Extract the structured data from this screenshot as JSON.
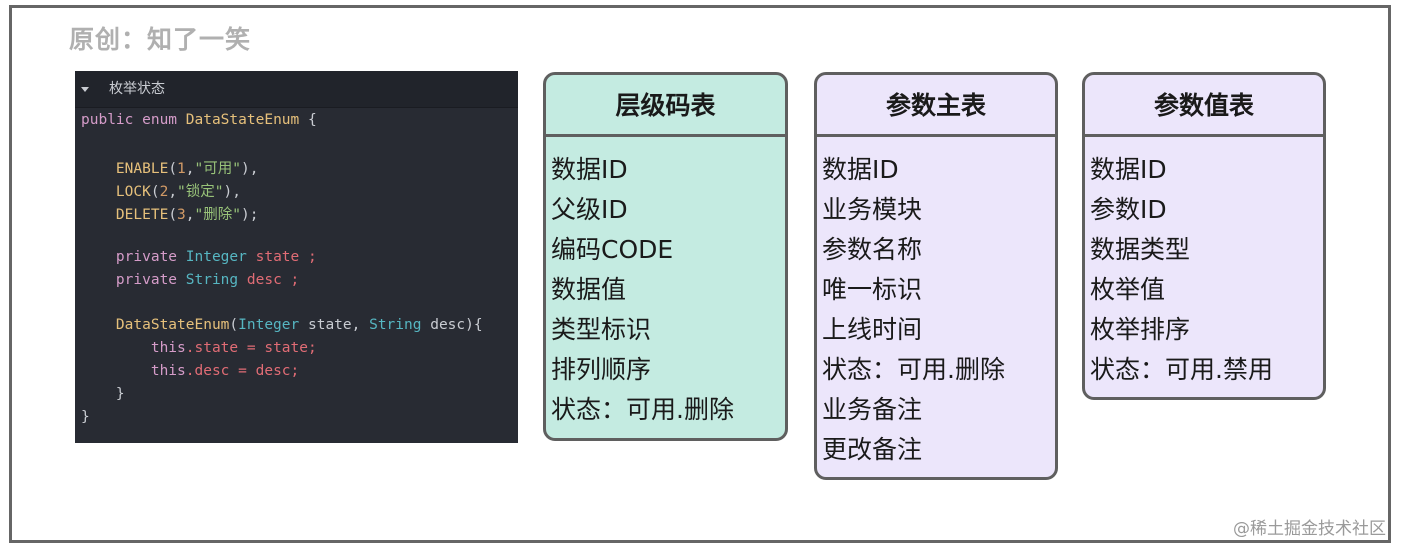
{
  "credit": "原创：知了一笑",
  "watermark": "@稀土掘金技术社区",
  "code_panel": {
    "header": "枚举状态",
    "lines": [
      {
        "segments": [
          {
            "t": "public enum ",
            "c": "kw"
          },
          {
            "t": "DataStateEnum",
            "c": "ty"
          },
          {
            "t": " {",
            "c": ""
          }
        ]
      },
      {
        "segments": [
          {
            "t": "    ENABLE",
            "c": "fn"
          },
          {
            "t": "(",
            "c": ""
          },
          {
            "t": "1",
            "c": "num"
          },
          {
            "t": ",",
            "c": ""
          },
          {
            "t": "\"可用\"",
            "c": "str"
          },
          {
            "t": "),",
            "c": ""
          }
        ]
      },
      {
        "segments": [
          {
            "t": "    LOCK",
            "c": "fn"
          },
          {
            "t": "(",
            "c": ""
          },
          {
            "t": "2",
            "c": "num"
          },
          {
            "t": ",",
            "c": ""
          },
          {
            "t": "\"锁定\"",
            "c": "str"
          },
          {
            "t": "),",
            "c": ""
          }
        ]
      },
      {
        "segments": [
          {
            "t": "    DELETE",
            "c": "fn"
          },
          {
            "t": "(",
            "c": ""
          },
          {
            "t": "3",
            "c": "num"
          },
          {
            "t": ",",
            "c": ""
          },
          {
            "t": "\"删除\"",
            "c": "str"
          },
          {
            "t": ");",
            "c": ""
          }
        ]
      },
      {
        "segments": [
          {
            "t": "    private ",
            "c": "kw"
          },
          {
            "t": "Integer",
            "c": "ty2"
          },
          {
            "t": " state ;",
            "c": "fld"
          }
        ]
      },
      {
        "segments": [
          {
            "t": "    private ",
            "c": "kw"
          },
          {
            "t": "String",
            "c": "ty2"
          },
          {
            "t": " desc ;",
            "c": "fld"
          }
        ]
      },
      {
        "segments": [
          {
            "t": "    DataStateEnum",
            "c": "fn"
          },
          {
            "t": "(",
            "c": ""
          },
          {
            "t": "Integer",
            "c": "ty2"
          },
          {
            "t": " state, ",
            "c": ""
          },
          {
            "t": "String",
            "c": "ty2"
          },
          {
            "t": " desc){",
            "c": ""
          }
        ]
      },
      {
        "segments": [
          {
            "t": "        this",
            "c": "kw"
          },
          {
            "t": ".state = state;",
            "c": "fld"
          }
        ]
      },
      {
        "segments": [
          {
            "t": "        this",
            "c": "kw"
          },
          {
            "t": ".desc = desc;",
            "c": "fld"
          }
        ]
      },
      {
        "segments": [
          {
            "t": "    }",
            "c": ""
          }
        ]
      },
      {
        "segments": [
          {
            "t": "}",
            "c": ""
          }
        ]
      }
    ]
  },
  "tables": [
    {
      "title": "层级码表",
      "rows": [
        "数据ID",
        "父级ID",
        "编码CODE",
        "数据值",
        "类型标识",
        "排列顺序",
        "状态：可用.删除"
      ]
    },
    {
      "title": "参数主表",
      "rows": [
        "数据ID",
        "业务模块",
        "参数名称",
        "唯一标识",
        "上线时间",
        "状态：可用.删除",
        "业务备注",
        "更改备注"
      ]
    },
    {
      "title": "参数值表",
      "rows": [
        "数据ID",
        "参数ID",
        "数据类型",
        "枚举值",
        "枚举排序",
        "状态：可用.禁用"
      ]
    }
  ],
  "colors": {
    "code_bg": "#282b33",
    "table1_bg": "#c4ebe1",
    "table2_bg": "#ece6fb",
    "table3_bg": "#ece6fb",
    "border": "#5f5f5f"
  }
}
